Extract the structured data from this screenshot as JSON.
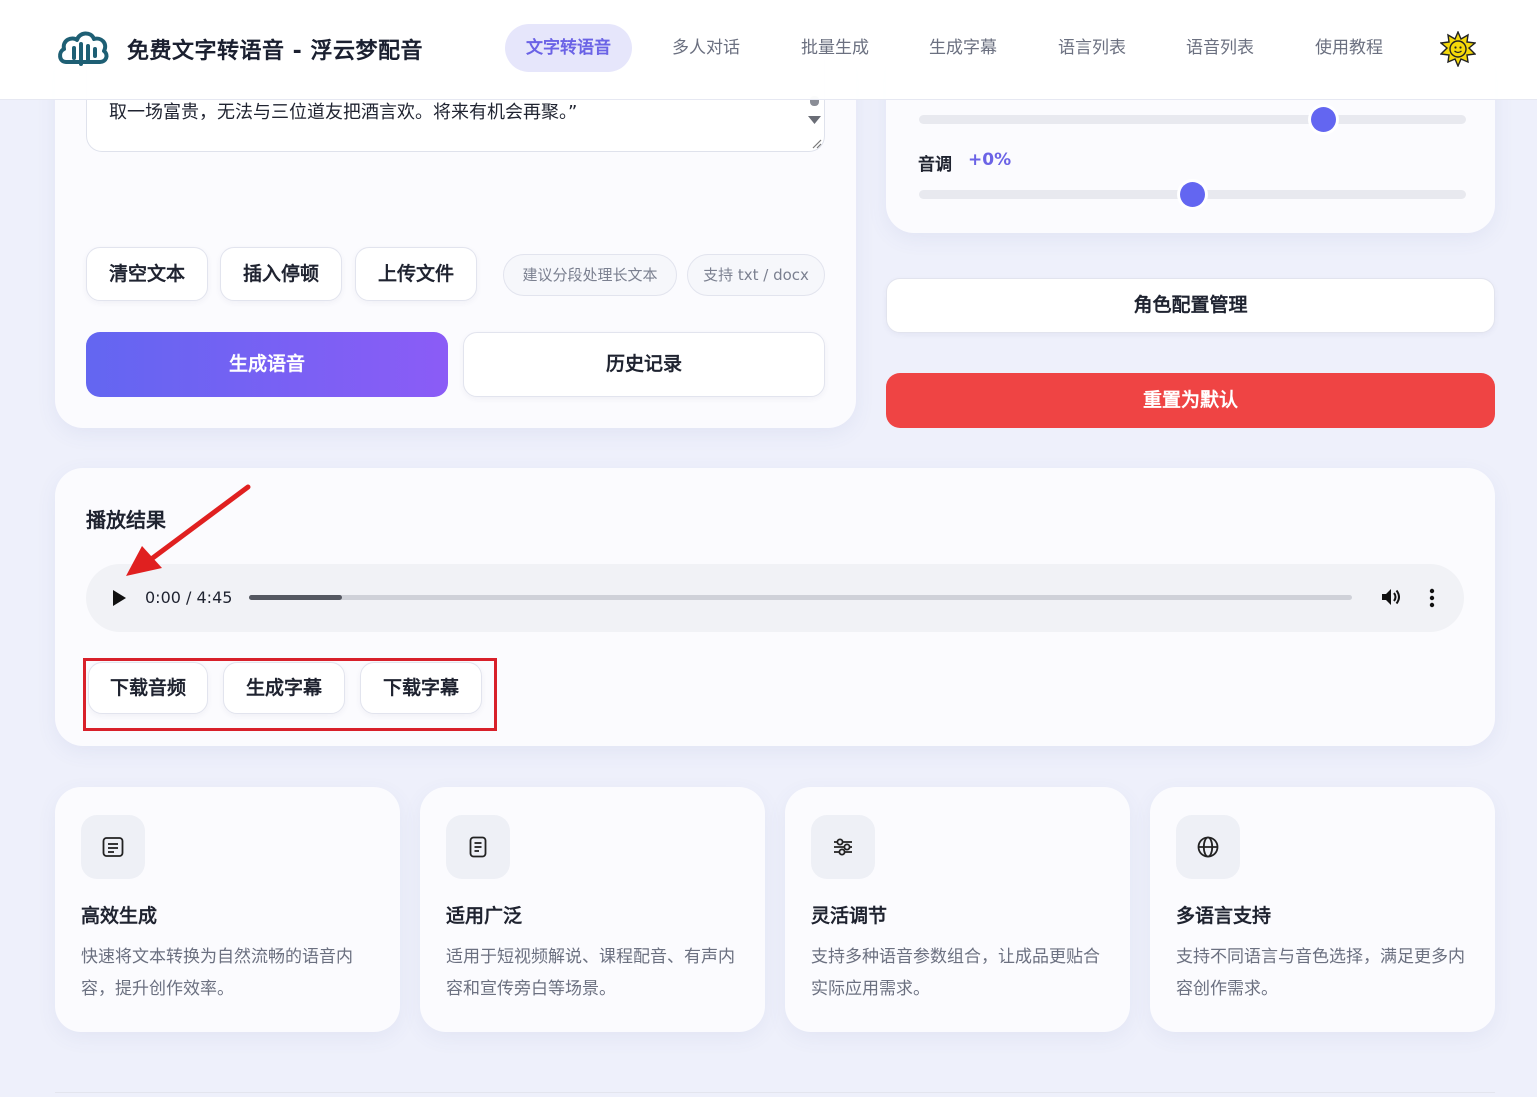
{
  "header": {
    "brand": "免费文字转语音 - 浮云梦配音",
    "nav": [
      {
        "label": "文字转语音",
        "active": true
      },
      {
        "label": "多人对话",
        "active": false
      },
      {
        "label": "批量生成",
        "active": false
      },
      {
        "label": "生成字幕",
        "active": false
      },
      {
        "label": "语言列表",
        "active": false
      },
      {
        "label": "语音列表",
        "active": false
      },
      {
        "label": "使用教程",
        "active": false
      }
    ],
    "theme_icon": "sun-icon"
  },
  "editor": {
    "text": "取一场富贵，无法与三位道友把酒言欢。将来有机会再聚。”",
    "buttons": {
      "clear": "清空文本",
      "insert_pause": "插入停顿",
      "upload": "上传文件"
    },
    "hints": {
      "long_text": "建议分段处理长文本",
      "formats": "支持 txt / docx"
    },
    "generate": "生成语音",
    "history": "历史记录"
  },
  "settings": {
    "speed_percent": 74,
    "pitch_label": "音调",
    "pitch_value": "+0%",
    "pitch_percent": 50,
    "role_config": "角色配置管理",
    "reset": "重置为默认"
  },
  "result": {
    "title": "播放结果",
    "time": "0:00 / 4:45",
    "progress_percent": 8.4,
    "download_audio": "下载音频",
    "generate_subtitle": "生成字幕",
    "download_subtitle": "下载字幕"
  },
  "features": [
    {
      "icon": "document-lines-icon",
      "title": "高效生成",
      "desc": "快速将文本转换为自然流畅的语音内容，提升创作效率。"
    },
    {
      "icon": "file-icon",
      "title": "适用广泛",
      "desc": "适用于短视频解说、课程配音、有声内容和宣传旁白等场景。"
    },
    {
      "icon": "sliders-icon",
      "title": "灵活调节",
      "desc": "支持多种语音参数组合，让成品更贴合实际应用需求。"
    },
    {
      "icon": "globe-icon",
      "title": "多语言支持",
      "desc": "支持不同语言与音色选择，满足更多内容创作需求。"
    }
  ],
  "colors": {
    "accent": "#6366f1",
    "accent_end": "#8b5cf6",
    "danger": "#ef4444",
    "annotation": "#d8202a"
  }
}
